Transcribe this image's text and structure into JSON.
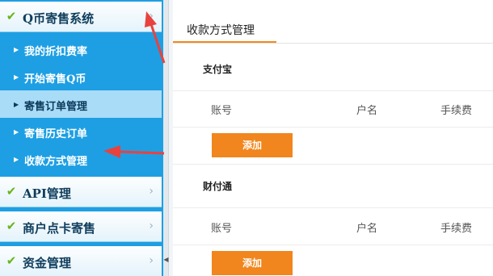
{
  "sidebar": {
    "sections": [
      {
        "title": "Q币寄售系统",
        "items": [
          {
            "label": "我的折扣费率"
          },
          {
            "label": "开始寄售Q币"
          },
          {
            "label": "寄售订单管理"
          },
          {
            "label": "寄售历史订单"
          },
          {
            "label": "收款方式管理"
          }
        ]
      },
      {
        "title": "API管理"
      },
      {
        "title": "商户点卡寄售"
      },
      {
        "title": "资金管理"
      }
    ]
  },
  "main": {
    "tab_title": "收款方式管理",
    "methods": [
      {
        "title": "支付宝",
        "columns": [
          "账号",
          "户名",
          "手续费"
        ],
        "add_label": "添加"
      },
      {
        "title": "财付通",
        "columns": [
          "账号",
          "户名",
          "手续费"
        ],
        "add_label": "添加"
      }
    ]
  },
  "colors": {
    "sidebar_bg": "#1e9fe3",
    "active_item_bg": "#a8dcf7",
    "accent_orange": "#f0861d",
    "annotation_red": "#e8423f"
  },
  "icons": {
    "check": "✔",
    "chevron": "›",
    "arrow": "▶"
  }
}
